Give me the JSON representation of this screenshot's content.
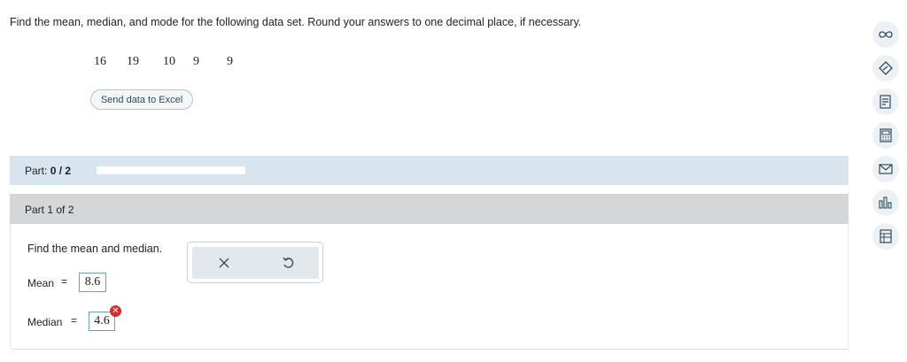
{
  "question": {
    "text": "Find the mean, median, and mode for the following data set. Round your answers to one decimal place, if necessary."
  },
  "dataset": {
    "values": [
      "16",
      "19",
      "10",
      "9",
      "9"
    ]
  },
  "excel_button": {
    "label": "Send data to Excel"
  },
  "part_bar": {
    "prefix": "Part: ",
    "progress_text": "0 / 2",
    "progress_fraction": 0
  },
  "part_header": {
    "label": "Part 1 of 2"
  },
  "panel": {
    "instruction": "Find the mean and median.",
    "mean": {
      "label": "Mean",
      "sign": "=",
      "value": "8.6"
    },
    "median": {
      "label": "Median",
      "sign": "=",
      "value": "4.6",
      "status": "incorrect"
    }
  },
  "tool_popup": {
    "clear_icon": "close-icon",
    "undo_icon": "undo-icon"
  },
  "side_tools": [
    {
      "icon": "infinity-icon"
    },
    {
      "icon": "compass-icon"
    },
    {
      "icon": "notes-icon"
    },
    {
      "icon": "calculator-icon"
    },
    {
      "icon": "mail-icon"
    },
    {
      "icon": "bar-chart-icon"
    },
    {
      "icon": "spreadsheet-icon"
    }
  ],
  "colors": {
    "accent": "#3a7fc1",
    "part_bar_bg": "#d8e5ef",
    "part_header_bg": "#d4d6d8",
    "error": "#d62b2b",
    "box_border": "#6a9fb5"
  }
}
